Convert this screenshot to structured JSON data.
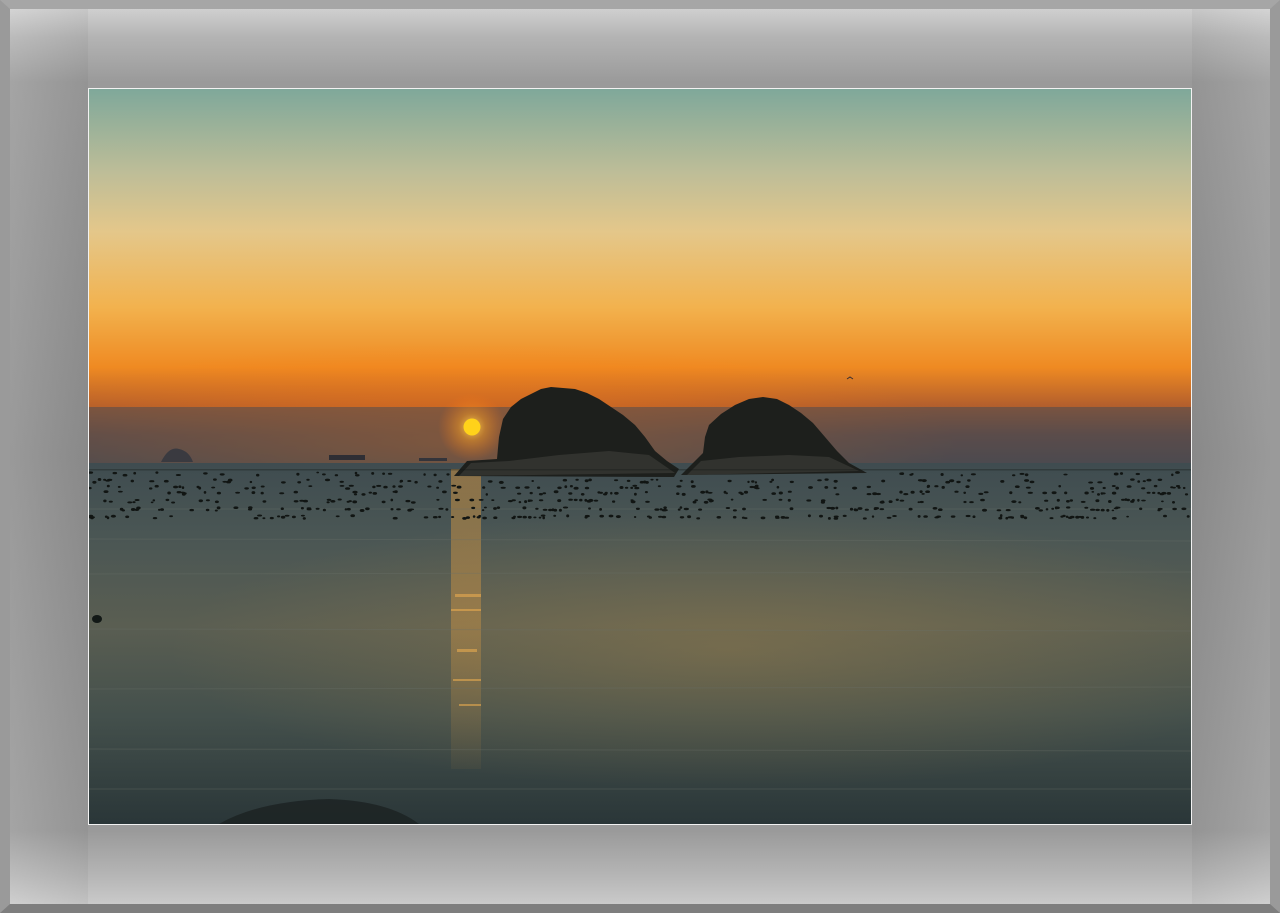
{
  "scene": {
    "subject": "sunset-over-sea-with-two-islands",
    "colors": {
      "sky_top": "#7fa89a",
      "sky_mid": "#e6c98a",
      "sky_glow": "#f08a20",
      "haze": "#4c4a4e",
      "sun": "#ffd21a",
      "sea_far": "#3a4a50",
      "sea_near": "#2c3a3c",
      "reflection": "#e0a040",
      "frame": "#9a9a9a",
      "mat_border": "#f2f2f2"
    }
  }
}
